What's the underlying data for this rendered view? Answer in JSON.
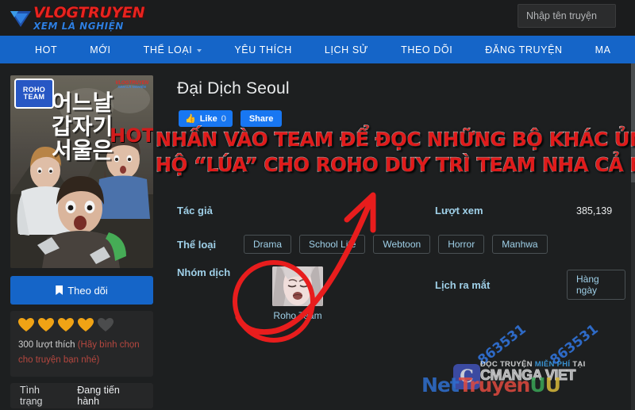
{
  "site": {
    "logo_primary": "VLOGTRUYEN",
    "logo_secondary": "XEM LÀ NGHIỆN",
    "logo_red": "#e8231f",
    "logo_blue": "#2f7fe0"
  },
  "header": {
    "search_placeholder": "Nhập tên truyện"
  },
  "nav": {
    "accent": "#1565c8",
    "items": [
      {
        "label": "HOT",
        "caret": false
      },
      {
        "label": "MỚI",
        "caret": false
      },
      {
        "label": "THỂ LOẠI",
        "caret": true
      },
      {
        "label": "YÊU THÍCH",
        "caret": false
      },
      {
        "label": "LỊCH SỬ",
        "caret": false
      },
      {
        "label": "THEO DÕI",
        "caret": false
      },
      {
        "label": "ĐĂNG TRUYỆN",
        "caret": false
      },
      {
        "label": "MA",
        "caret": false
      }
    ]
  },
  "cover": {
    "team_badge_line1": "ROHO",
    "team_badge_line2": "TEAM",
    "korean_title_line1": "어느날",
    "korean_title_line2": "갑자기",
    "korean_title_line3": "서울은",
    "watermark_top": "VLOGTRUYEN",
    "watermark_sub": "XEM LÀ NGHIỆN",
    "hot_label": "HOT"
  },
  "sidebar": {
    "follow_button": "Theo dõi",
    "hearts_filled": 4,
    "hearts_total": 5,
    "likes_count_text": "300 lượt thích",
    "likes_hint": "(Hãy bình chọn cho truyện bạn nhé)",
    "status_label": "Tình trạng",
    "status_value": "Đang tiến hành"
  },
  "main": {
    "title": "Đại Dịch Seoul",
    "social": {
      "like_label": "Like",
      "like_count": "0",
      "share_label": "Share"
    },
    "overlay_banner": {
      "line1": "NHẤN VÀO TEAM ĐỂ ĐỌC NHỮNG BỘ KHÁC ỦNG",
      "line2": "HỘ “LÚA” CHO ROHO DUY TRÌ TEAM NHA CẢ NHÀ!!",
      "color": "#e01b1b"
    },
    "fields": {
      "author_label": "Tác giả",
      "author_value": "",
      "views_label": "Lượt xem",
      "views_value": "385,139",
      "genres_label": "Thể loại",
      "genres": [
        "Drama",
        "School Life",
        "Webtoon",
        "Horror",
        "Manhwa"
      ],
      "team_label": "Nhóm dịch",
      "team_name": "Roho Team",
      "schedule_label": "Lịch ra mắt",
      "schedule_value": "Hàng ngày"
    }
  },
  "watermarks": {
    "number_1": "863531",
    "number_2": "863531",
    "cmanga_line1_a": "ĐỌC TRUYỆN ",
    "cmanga_line1_b": "MIỄN PHÍ ",
    "cmanga_line1_c": "TẠI",
    "cmanga_line2": "CMANGA VIET",
    "nettruyen_a": "Net",
    "nettruyen_b": "Truyen",
    "nettruyen_c": "U",
    "nettruyen_d": "U"
  }
}
